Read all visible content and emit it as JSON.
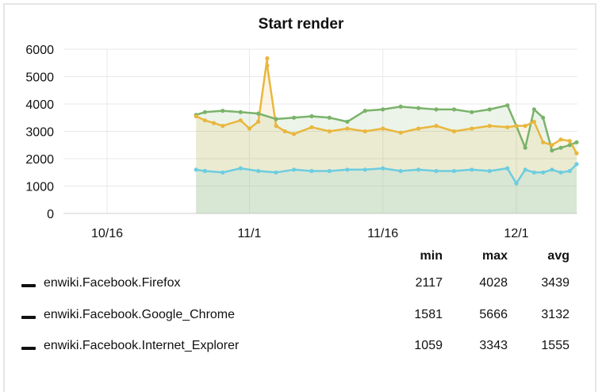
{
  "chart_data": {
    "type": "line",
    "title": "Start render",
    "ylim": [
      0,
      6000
    ],
    "yticks": [
      0,
      1000,
      2000,
      3000,
      4000,
      5000,
      6000
    ],
    "x_tick_labels": [
      "10/16",
      "11/1",
      "11/16",
      "12/1"
    ],
    "grid": true,
    "series": [
      {
        "name": "enwiki.Facebook.Firefox",
        "color": "#7ab36a",
        "min": 2117,
        "max": 4028,
        "avg": 3439,
        "x": [
          "10/26",
          "10/27",
          "10/29",
          "10/31",
          "11/2",
          "11/4",
          "11/6",
          "11/8",
          "11/10",
          "11/12",
          "11/14",
          "11/16",
          "11/18",
          "11/20",
          "11/22",
          "11/24",
          "11/26",
          "11/28",
          "11/30",
          "12/1",
          "12/2",
          "12/3",
          "12/4",
          "12/5",
          "12/6",
          "12/7",
          "12/8"
        ],
        "y": [
          3600,
          3700,
          3750,
          3700,
          3650,
          3450,
          3500,
          3550,
          3500,
          3350,
          3750,
          3800,
          3900,
          3850,
          3800,
          3800,
          3700,
          3800,
          3950,
          3200,
          2400,
          3800,
          3500,
          2300,
          2400,
          2500,
          2600
        ]
      },
      {
        "name": "enwiki.Facebook.Google_Chrome",
        "color": "#e9b73d",
        "min": 1581,
        "max": 5666,
        "avg": 3132,
        "x": [
          "10/26",
          "10/27",
          "10/28",
          "10/29",
          "10/31",
          "11/1",
          "11/2",
          "11/3",
          "11/3",
          "11/4",
          "11/5",
          "11/6",
          "11/8",
          "11/10",
          "11/12",
          "11/14",
          "11/16",
          "11/18",
          "11/20",
          "11/22",
          "11/24",
          "11/26",
          "11/28",
          "11/30",
          "12/1",
          "12/2",
          "12/3",
          "12/4",
          "12/5",
          "12/6",
          "12/7",
          "12/8"
        ],
        "y": [
          3550,
          3400,
          3300,
          3200,
          3400,
          3100,
          3350,
          5666,
          5400,
          3200,
          3000,
          2900,
          3150,
          3000,
          3100,
          3000,
          3100,
          2950,
          3100,
          3200,
          3000,
          3100,
          3200,
          3150,
          3200,
          3200,
          3350,
          2600,
          2500,
          2700,
          2650,
          2200
        ]
      },
      {
        "name": "enwiki.Facebook.Internet_Explorer",
        "color": "#6ccde0",
        "min": 1059,
        "max": 3343,
        "avg": 1555,
        "x": [
          "10/26",
          "10/27",
          "10/29",
          "10/31",
          "11/2",
          "11/4",
          "11/6",
          "11/8",
          "11/10",
          "11/12",
          "11/14",
          "11/16",
          "11/18",
          "11/20",
          "11/22",
          "11/24",
          "11/26",
          "11/28",
          "11/30",
          "12/1",
          "12/2",
          "12/3",
          "12/4",
          "12/5",
          "12/6",
          "12/7",
          "12/8"
        ],
        "y": [
          1600,
          1550,
          1500,
          1650,
          1550,
          1500,
          1600,
          1550,
          1550,
          1600,
          1600,
          1650,
          1550,
          1600,
          1550,
          1550,
          1600,
          1550,
          1650,
          1100,
          1600,
          1500,
          1500,
          1600,
          1500,
          1550,
          1800
        ]
      }
    ]
  },
  "legend": {
    "headers": {
      "min": "min",
      "max": "max",
      "avg": "avg"
    }
  }
}
